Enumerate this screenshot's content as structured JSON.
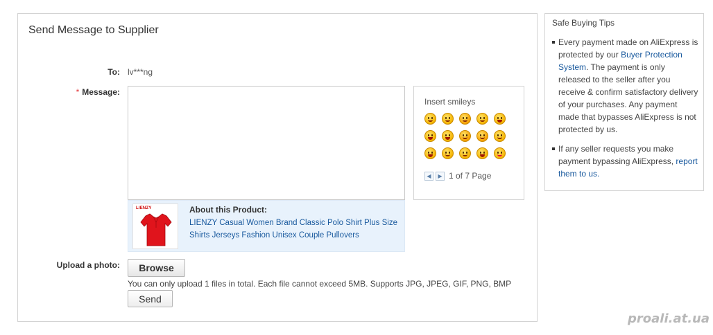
{
  "panel": {
    "title": "Send Message to Supplier"
  },
  "form": {
    "to_label": "To:",
    "to_value": "lv***ng",
    "required_mark": "*",
    "message_label": "Message:",
    "message_value": "",
    "upload_label": "Upload a photo:",
    "browse_label": "Browse",
    "upload_note": "You can only upload 1 files in total. Each file cannot exceed 5MB. Supports JPG, JPEG, GIF, PNG, BMP",
    "send_label": "Send"
  },
  "product": {
    "brand": "LIENZY",
    "about_title": "About this Product:",
    "link_text": "LIENZY Casual Women Brand Classic Polo Shirt Plus Size Shirts Jerseys Fashion Unisex Couple Pullovers",
    "shirt_color": "#e0141c"
  },
  "smileys": {
    "title": "Insert smileys",
    "items": [
      "smile",
      "wink",
      "tongue",
      "grin",
      "laugh",
      "big-grin",
      "cry-laugh",
      "shy",
      "blush",
      "kiss",
      "laugh2",
      "giggle",
      "squint",
      "surprised",
      "heart-eyes"
    ],
    "pager": {
      "prev_icon": "arrow-left-icon",
      "next_icon": "arrow-right-icon",
      "text": "1 of 7 Page"
    }
  },
  "tips": {
    "title": "Safe Buying Tips",
    "tip1_before": "Every payment made on AliExpress is protected by our ",
    "tip1_link": "Buyer Protection System",
    "tip1_after": ". The payment is only released to the seller after you receive & confirm satisfactory delivery of your purchases. Any payment made that bypasses AliExpress is not protected by us.",
    "tip2_before": "If any seller requests you make payment bypassing AliExpress, ",
    "tip2_link": "report them to us."
  },
  "watermark": "proali.at.ua",
  "colors": {
    "link": "#1a5a9e",
    "product_bg": "#e8f2fc",
    "required": "#e4393c"
  }
}
